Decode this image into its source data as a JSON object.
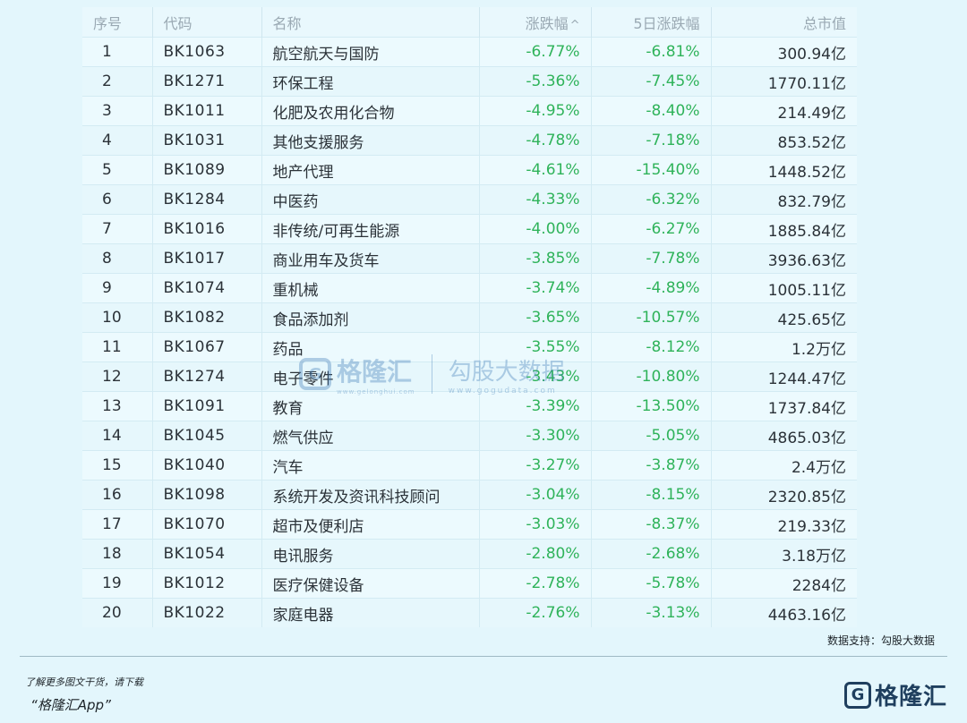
{
  "table": {
    "headers": {
      "index": "序号",
      "code": "代码",
      "name": "名称",
      "change": "涨跌幅",
      "change_sort_arrow": "^",
      "change5d": "5日涨跌幅",
      "market_cap": "总市值"
    },
    "rows": [
      {
        "index": "1",
        "code": "BK1063",
        "name": "航空航天与国防",
        "change": "-6.77%",
        "change5d": "-6.81%",
        "market_cap": "300.94亿"
      },
      {
        "index": "2",
        "code": "BK1271",
        "name": "环保工程",
        "change": "-5.36%",
        "change5d": "-7.45%",
        "market_cap": "1770.11亿"
      },
      {
        "index": "3",
        "code": "BK1011",
        "name": "化肥及农用化合物",
        "change": "-4.95%",
        "change5d": "-8.40%",
        "market_cap": "214.49亿"
      },
      {
        "index": "4",
        "code": "BK1031",
        "name": "其他支援服务",
        "change": "-4.78%",
        "change5d": "-7.18%",
        "market_cap": "853.52亿"
      },
      {
        "index": "5",
        "code": "BK1089",
        "name": "地产代理",
        "change": "-4.61%",
        "change5d": "-15.40%",
        "market_cap": "1448.52亿"
      },
      {
        "index": "6",
        "code": "BK1284",
        "name": "中医药",
        "change": "-4.33%",
        "change5d": "-6.32%",
        "market_cap": "832.79亿"
      },
      {
        "index": "7",
        "code": "BK1016",
        "name": "非传统/可再生能源",
        "change": "-4.00%",
        "change5d": "-6.27%",
        "market_cap": "1885.84亿"
      },
      {
        "index": "8",
        "code": "BK1017",
        "name": "商业用车及货车",
        "change": "-3.85%",
        "change5d": "-7.78%",
        "market_cap": "3936.63亿"
      },
      {
        "index": "9",
        "code": "BK1074",
        "name": "重机械",
        "change": "-3.74%",
        "change5d": "-4.89%",
        "market_cap": "1005.11亿"
      },
      {
        "index": "10",
        "code": "BK1082",
        "name": "食品添加剂",
        "change": "-3.65%",
        "change5d": "-10.57%",
        "market_cap": "425.65亿"
      },
      {
        "index": "11",
        "code": "BK1067",
        "name": "药品",
        "change": "-3.55%",
        "change5d": "-8.12%",
        "market_cap": "1.2万亿"
      },
      {
        "index": "12",
        "code": "BK1274",
        "name": "电子零件",
        "change": "-3.43%",
        "change5d": "-10.80%",
        "market_cap": "1244.47亿"
      },
      {
        "index": "13",
        "code": "BK1091",
        "name": "教育",
        "change": "-3.39%",
        "change5d": "-13.50%",
        "market_cap": "1737.84亿"
      },
      {
        "index": "14",
        "code": "BK1045",
        "name": "燃气供应",
        "change": "-3.30%",
        "change5d": "-5.05%",
        "market_cap": "4865.03亿"
      },
      {
        "index": "15",
        "code": "BK1040",
        "name": "汽车",
        "change": "-3.27%",
        "change5d": "-3.87%",
        "market_cap": "2.4万亿"
      },
      {
        "index": "16",
        "code": "BK1098",
        "name": "系统开发及资讯科技顾问",
        "change": "-3.04%",
        "change5d": "-8.15%",
        "market_cap": "2320.85亿"
      },
      {
        "index": "17",
        "code": "BK1070",
        "name": "超市及便利店",
        "change": "-3.03%",
        "change5d": "-8.37%",
        "market_cap": "219.33亿"
      },
      {
        "index": "18",
        "code": "BK1054",
        "name": "电讯服务",
        "change": "-2.80%",
        "change5d": "-2.68%",
        "market_cap": "3.18万亿"
      },
      {
        "index": "19",
        "code": "BK1012",
        "name": "医疗保健设备",
        "change": "-2.78%",
        "change5d": "-5.78%",
        "market_cap": "2284亿"
      },
      {
        "index": "20",
        "code": "BK1022",
        "name": "家庭电器",
        "change": "-2.76%",
        "change5d": "-3.13%",
        "market_cap": "4463.16亿"
      }
    ]
  },
  "source_note": "数据支持：勾股大数据",
  "footer": {
    "cta_line1": "了解更多图文干货，请下载",
    "cta_line2": "“格隆汇App”",
    "logo_mark": "G",
    "logo_text": "格隆汇"
  },
  "watermark": {
    "mark": "G",
    "name1": "格隆汇",
    "url1": "www.gelonghui.com",
    "name2": "勾股大数据",
    "url2": "www.gogudata.com"
  },
  "colors": {
    "negative": "#2fb35a",
    "background": "#e3f6fc",
    "brand": "#1f3f5e"
  }
}
